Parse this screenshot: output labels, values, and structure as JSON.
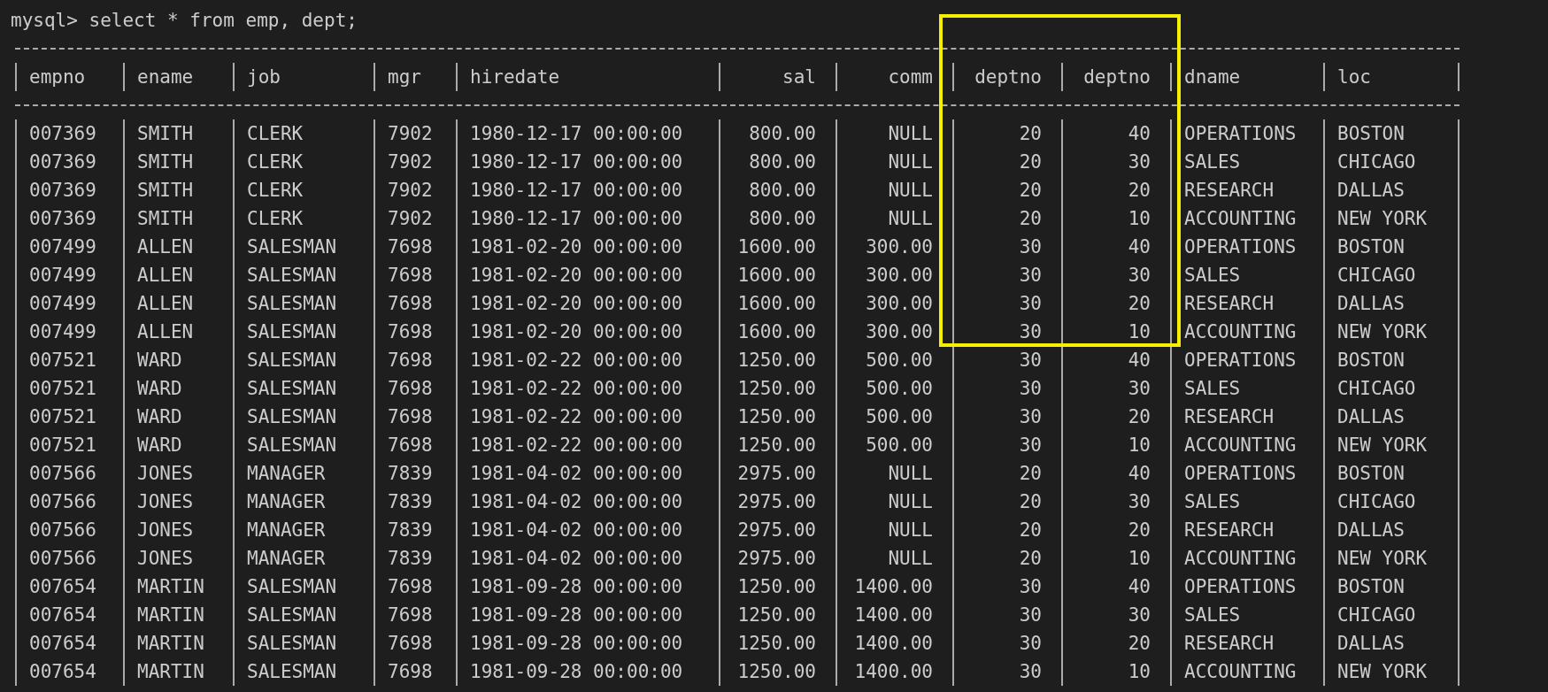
{
  "terminal": {
    "command_line": "mysql> select * from emp, dept;",
    "columns": [
      "empno",
      "ename",
      "job",
      "mgr",
      "hiredate",
      "sal",
      "comm",
      "deptno",
      "deptno",
      "dname",
      "loc"
    ],
    "rows": [
      [
        "007369",
        "SMITH",
        "CLERK",
        "7902",
        "1980-12-17 00:00:00",
        "800.00",
        "NULL",
        "20",
        "40",
        "OPERATIONS",
        "BOSTON"
      ],
      [
        "007369",
        "SMITH",
        "CLERK",
        "7902",
        "1980-12-17 00:00:00",
        "800.00",
        "NULL",
        "20",
        "30",
        "SALES",
        "CHICAGO"
      ],
      [
        "007369",
        "SMITH",
        "CLERK",
        "7902",
        "1980-12-17 00:00:00",
        "800.00",
        "NULL",
        "20",
        "20",
        "RESEARCH",
        "DALLAS"
      ],
      [
        "007369",
        "SMITH",
        "CLERK",
        "7902",
        "1980-12-17 00:00:00",
        "800.00",
        "NULL",
        "20",
        "10",
        "ACCOUNTING",
        "NEW YORK"
      ],
      [
        "007499",
        "ALLEN",
        "SALESMAN",
        "7698",
        "1981-02-20 00:00:00",
        "1600.00",
        "300.00",
        "30",
        "40",
        "OPERATIONS",
        "BOSTON"
      ],
      [
        "007499",
        "ALLEN",
        "SALESMAN",
        "7698",
        "1981-02-20 00:00:00",
        "1600.00",
        "300.00",
        "30",
        "30",
        "SALES",
        "CHICAGO"
      ],
      [
        "007499",
        "ALLEN",
        "SALESMAN",
        "7698",
        "1981-02-20 00:00:00",
        "1600.00",
        "300.00",
        "30",
        "20",
        "RESEARCH",
        "DALLAS"
      ],
      [
        "007499",
        "ALLEN",
        "SALESMAN",
        "7698",
        "1981-02-20 00:00:00",
        "1600.00",
        "300.00",
        "30",
        "10",
        "ACCOUNTING",
        "NEW YORK"
      ],
      [
        "007521",
        "WARD",
        "SALESMAN",
        "7698",
        "1981-02-22 00:00:00",
        "1250.00",
        "500.00",
        "30",
        "40",
        "OPERATIONS",
        "BOSTON"
      ],
      [
        "007521",
        "WARD",
        "SALESMAN",
        "7698",
        "1981-02-22 00:00:00",
        "1250.00",
        "500.00",
        "30",
        "30",
        "SALES",
        "CHICAGO"
      ],
      [
        "007521",
        "WARD",
        "SALESMAN",
        "7698",
        "1981-02-22 00:00:00",
        "1250.00",
        "500.00",
        "30",
        "20",
        "RESEARCH",
        "DALLAS"
      ],
      [
        "007521",
        "WARD",
        "SALESMAN",
        "7698",
        "1981-02-22 00:00:00",
        "1250.00",
        "500.00",
        "30",
        "10",
        "ACCOUNTING",
        "NEW YORK"
      ],
      [
        "007566",
        "JONES",
        "MANAGER",
        "7839",
        "1981-04-02 00:00:00",
        "2975.00",
        "NULL",
        "20",
        "40",
        "OPERATIONS",
        "BOSTON"
      ],
      [
        "007566",
        "JONES",
        "MANAGER",
        "7839",
        "1981-04-02 00:00:00",
        "2975.00",
        "NULL",
        "20",
        "30",
        "SALES",
        "CHICAGO"
      ],
      [
        "007566",
        "JONES",
        "MANAGER",
        "7839",
        "1981-04-02 00:00:00",
        "2975.00",
        "NULL",
        "20",
        "20",
        "RESEARCH",
        "DALLAS"
      ],
      [
        "007566",
        "JONES",
        "MANAGER",
        "7839",
        "1981-04-02 00:00:00",
        "2975.00",
        "NULL",
        "20",
        "10",
        "ACCOUNTING",
        "NEW YORK"
      ],
      [
        "007654",
        "MARTIN",
        "SALESMAN",
        "7698",
        "1981-09-28 00:00:00",
        "1250.00",
        "1400.00",
        "30",
        "40",
        "OPERATIONS",
        "BOSTON"
      ],
      [
        "007654",
        "MARTIN",
        "SALESMAN",
        "7698",
        "1981-09-28 00:00:00",
        "1250.00",
        "1400.00",
        "30",
        "30",
        "SALES",
        "CHICAGO"
      ],
      [
        "007654",
        "MARTIN",
        "SALESMAN",
        "7698",
        "1981-09-28 00:00:00",
        "1250.00",
        "1400.00",
        "30",
        "20",
        "RESEARCH",
        "DALLAS"
      ],
      [
        "007654",
        "MARTIN",
        "SALESMAN",
        "7698",
        "1981-09-28 00:00:00",
        "1250.00",
        "1400.00",
        "30",
        "10",
        "ACCOUNTING",
        "NEW YORK"
      ]
    ]
  }
}
